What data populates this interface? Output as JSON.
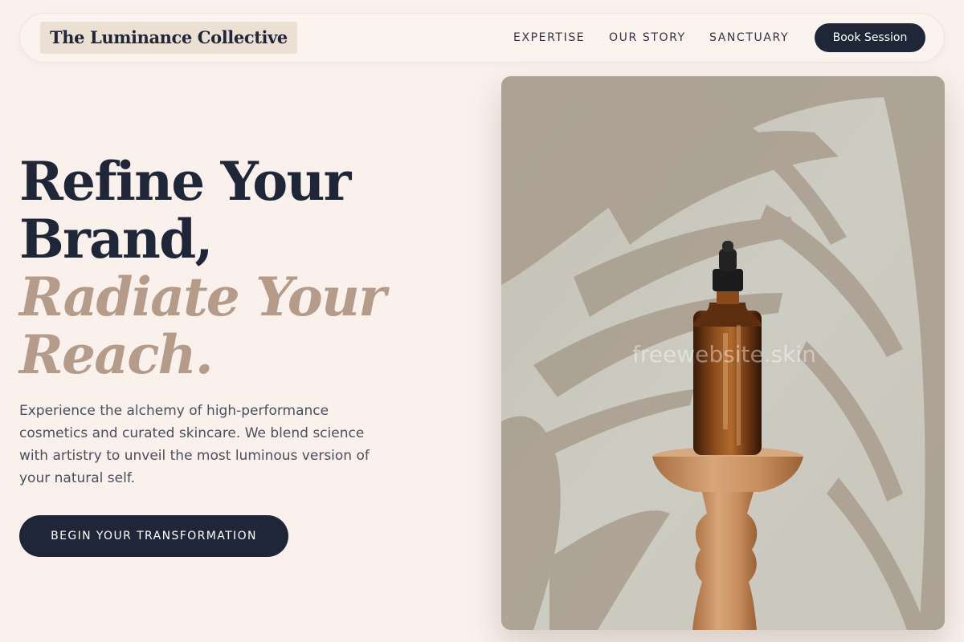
{
  "nav": {
    "brand": "The Luminance Collective",
    "links": [
      "EXPERTISE",
      "OUR STORY",
      "SANCTUARY"
    ],
    "cta": "Book Session"
  },
  "hero": {
    "title_line1": "Refine Your",
    "title_line2": "Brand,",
    "accent_line1": "Radiate Your",
    "accent_line2": "Reach.",
    "lead": "Experience the alchemy of high-performance cosmetics and curated skincare. We blend science with artistry to unveil the most luminous version of your natural self.",
    "cta": "BEGIN YOUR TRANSFORMATION"
  },
  "image": {
    "watermark": "freewebsite.skin"
  },
  "colors": {
    "background": "#faf1ec",
    "navy": "#1e2638",
    "accent": "#b59b8a",
    "brand_highlight": "#ecdfd4"
  }
}
